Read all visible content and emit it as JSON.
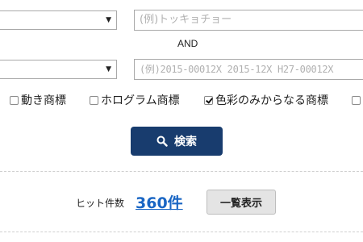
{
  "filters": {
    "select1": {
      "value": "",
      "arrow": "▼"
    },
    "select2": {
      "value": "",
      "arrow": "▼"
    },
    "input1_placeholder": "(例)トッキョチョー",
    "and_label": "AND",
    "input2_placeholder": "(例)2015-00012X 2015-12X H27-00012X"
  },
  "checkboxes": [
    {
      "label": "動き商標",
      "checked": false
    },
    {
      "label": "ホログラム商標",
      "checked": false
    },
    {
      "label": "色彩のみからなる商標",
      "checked": true
    },
    {
      "label": "",
      "checked": false
    }
  ],
  "search_button": {
    "label": "検索",
    "icon": "search-icon",
    "color": "#183c6e"
  },
  "results": {
    "hit_label": "ヒット件数",
    "hit_count": "360件",
    "list_button": "一覧表示",
    "count_color": "#1a66c4"
  }
}
